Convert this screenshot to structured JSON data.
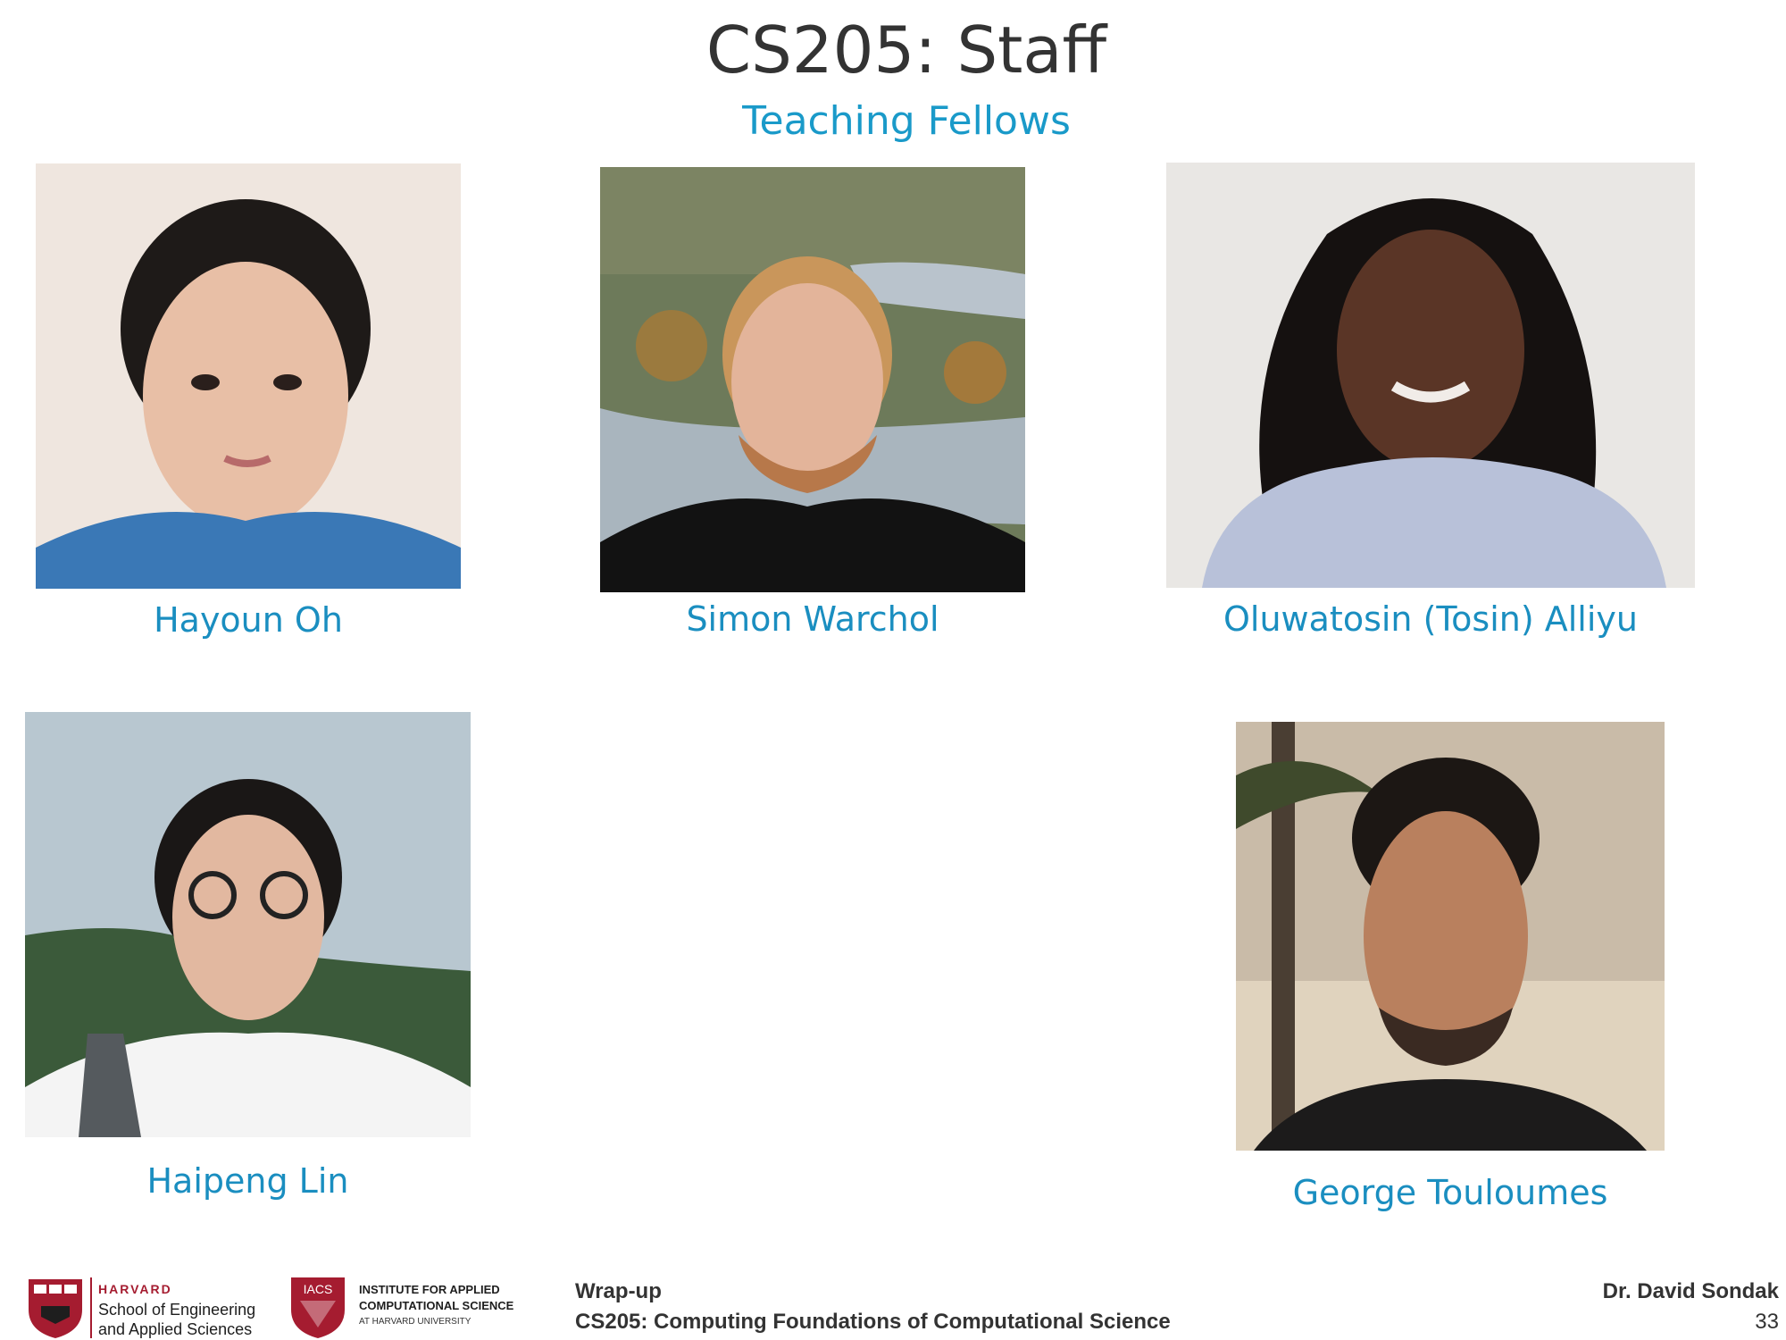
{
  "slide": {
    "title": "CS205: Staff",
    "subtitle": "Teaching Fellows"
  },
  "fellows": [
    {
      "name": "Hayoun Oh"
    },
    {
      "name": "Simon Warchol"
    },
    {
      "name": "Oluwatosin (Tosin) Alliyu"
    },
    {
      "name": "Haipeng Lin"
    },
    {
      "name": "George Touloumes"
    }
  ],
  "footer": {
    "harvard_line1": "HARVARD",
    "harvard_line2": "School of Engineering",
    "harvard_line3": "and Applied Sciences",
    "iacs_badge": "IACS",
    "iacs_line1": "INSTITUTE FOR APPLIED",
    "iacs_line2": "COMPUTATIONAL SCIENCE",
    "iacs_line3": "AT HARVARD UNIVERSITY",
    "section": "Wrap-up",
    "course": "CS205: Computing Foundations of Computational Science",
    "author": "Dr. David Sondak",
    "page_number": "33"
  },
  "colors": {
    "title": "#333333",
    "accent": "#1a9ac9",
    "harvard_red": "#a51c30"
  }
}
